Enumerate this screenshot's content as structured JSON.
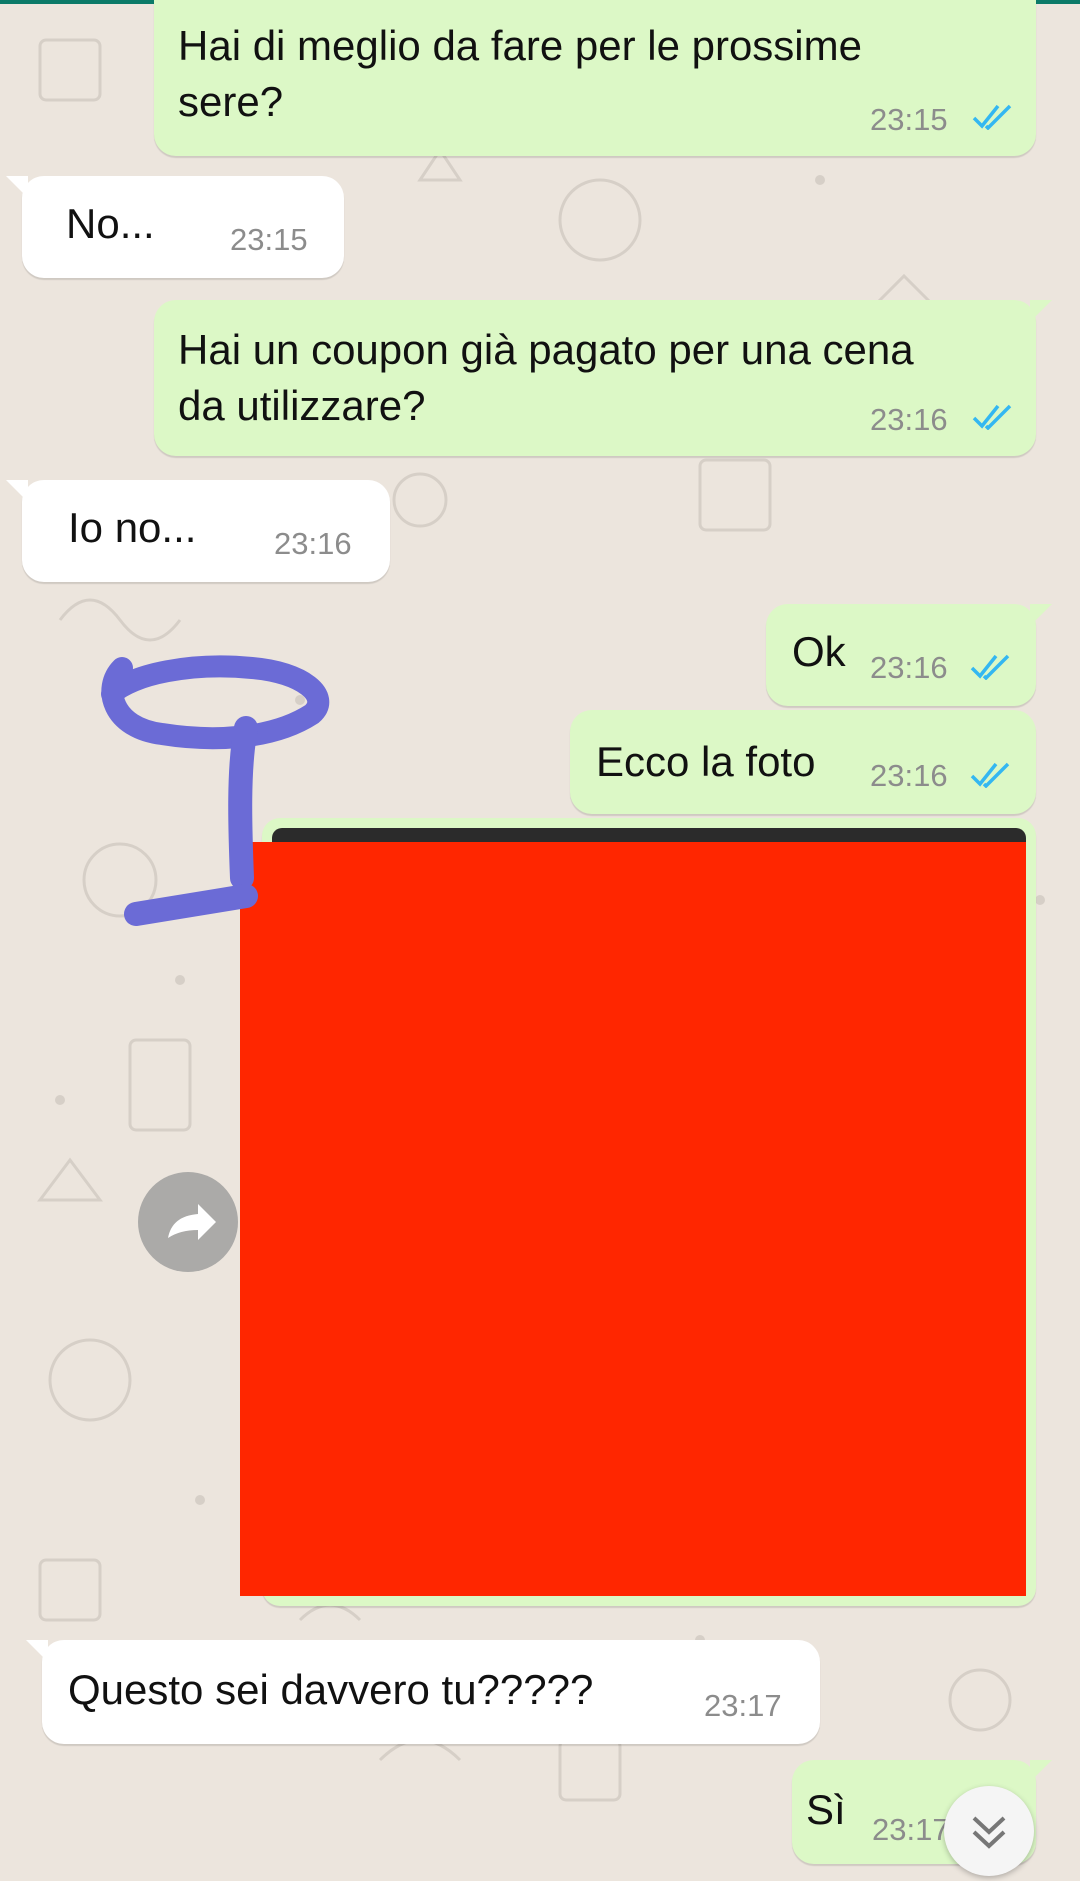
{
  "colors": {
    "outgoing_bubble": "#dcf8c6",
    "incoming_bubble": "#ffffff",
    "chat_background": "#ece5dd",
    "read_ticks": "#34b7f1",
    "redaction": "#ff2600",
    "scribble": "#6b6bd6"
  },
  "messages": [
    {
      "direction": "out",
      "text_line1": "Hai di meglio da fare per le prossime",
      "text_line2": "sere?",
      "time": "23:15",
      "status": "read"
    },
    {
      "direction": "in",
      "text": "No...",
      "time": "23:15"
    },
    {
      "direction": "out",
      "text_line1": "Hai un coupon già pagato per una cena",
      "text_line2": "da utilizzare?",
      "time": "23:16",
      "status": "read"
    },
    {
      "direction": "in",
      "text": "Io no...",
      "time": "23:16"
    },
    {
      "direction": "out",
      "text": "Ok",
      "time": "23:16",
      "status": "read"
    },
    {
      "direction": "out",
      "text": "Ecco la foto",
      "time": "23:16",
      "status": "read"
    },
    {
      "direction": "out",
      "type": "photo",
      "status": "redacted"
    },
    {
      "direction": "in",
      "text": "Questo sei davvero tu?????",
      "time": "23:17"
    },
    {
      "direction": "out",
      "text": "Sì",
      "time": "23:17",
      "status": "delivered"
    }
  ],
  "icons": {
    "forward": "forward-arrow-icon",
    "scroll_down": "chevron-double-down-icon",
    "read_receipt": "double-check-icon"
  }
}
